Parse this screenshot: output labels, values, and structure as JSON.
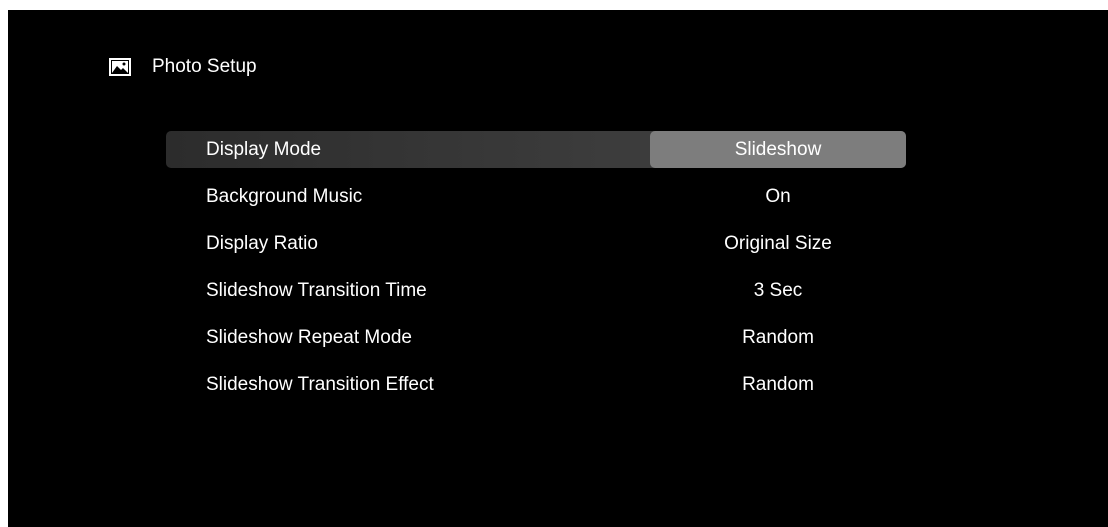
{
  "header": {
    "icon": "image-icon",
    "title": "Photo Setup"
  },
  "menu": {
    "items": [
      {
        "label": "Display Mode",
        "value": "Slideshow",
        "selected": true
      },
      {
        "label": "Background Music",
        "value": "On",
        "selected": false
      },
      {
        "label": "Display Ratio",
        "value": "Original Size",
        "selected": false
      },
      {
        "label": "Slideshow Transition Time",
        "value": "3 Sec",
        "selected": false
      },
      {
        "label": "Slideshow Repeat Mode",
        "value": "Random",
        "selected": false
      },
      {
        "label": "Slideshow Transition Effect",
        "value": "Random",
        "selected": false
      }
    ]
  },
  "colors": {
    "background": "#000000",
    "text": "#ffffff",
    "selected_row": "#3a3a3a",
    "selected_value": "#7d7d7d"
  }
}
